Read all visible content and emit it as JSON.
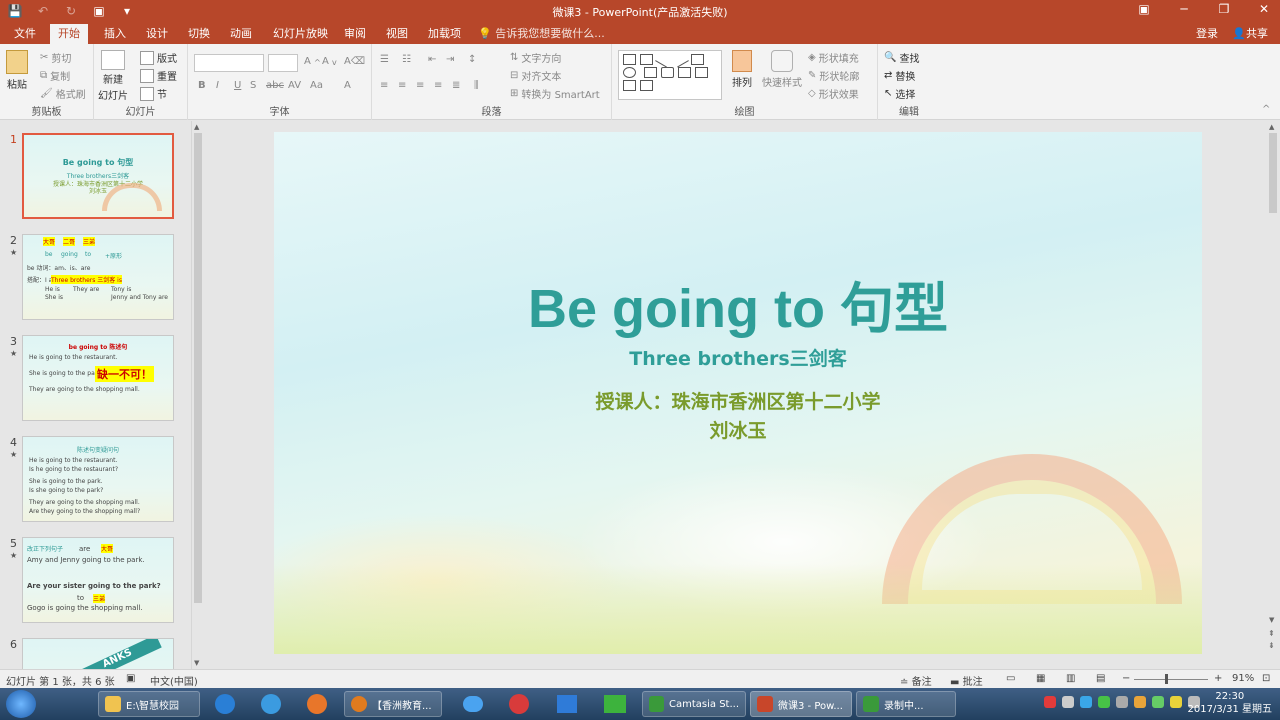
{
  "window": {
    "title": "微课3 - PowerPoint(产品激活失败)"
  },
  "tabs": [
    {
      "label": "文件"
    },
    {
      "label": "开始"
    },
    {
      "label": "插入"
    },
    {
      "label": "设计"
    },
    {
      "label": "切换"
    },
    {
      "label": "动画"
    },
    {
      "label": "幻灯片放映"
    },
    {
      "label": "审阅"
    },
    {
      "label": "视图"
    },
    {
      "label": "加载项"
    }
  ],
  "tellme": "告诉我您想要做什么...",
  "account": {
    "login": "登录",
    "share": "共享"
  },
  "ribbon": {
    "clipboard": {
      "paste": "粘贴",
      "cut": "剪切",
      "copy": "复制",
      "format_painter": "格式刷",
      "label": "剪贴板"
    },
    "slides": {
      "new_slide": "新建",
      "new_slide2": "幻灯片",
      "layout": "版式",
      "reset": "重置",
      "section": "节",
      "label": "幻灯片"
    },
    "font": {
      "label": "字体"
    },
    "paragraph": {
      "text_direction": "文字方向",
      "align_text": "对齐文本",
      "smartart": "转换为 SmartArt",
      "label": "段落"
    },
    "drawing": {
      "arrange": "排列",
      "quick_styles": "快速样式",
      "shape_fill": "形状填充",
      "shape_outline": "形状轮廓",
      "shape_effects": "形状效果",
      "label": "绘图"
    },
    "editing": {
      "find": "查找",
      "replace": "替换",
      "select": "选择",
      "label": "编辑"
    }
  },
  "thumbnails": [
    {
      "num": "1",
      "title": "Be going to 句型",
      "lines": [
        "Three brothers三剑客",
        "授课人：珠海市香洲区第十二小学",
        "刘冰玉"
      ]
    },
    {
      "num": "2",
      "lines": [
        "大哥",
        "二哥",
        "三弟",
        "be",
        "going",
        "to",
        "+原形",
        "be 动词：am、is、are",
        "搭配：I am",
        "Three brothers 三剑客 is",
        "He is",
        "They are",
        "Tony is",
        "She is",
        "Jenny and Tony are"
      ]
    },
    {
      "num": "3",
      "lines": [
        "be going to 陈述句",
        "He is going to the restaurant.",
        "She is going to the park.",
        "缺一不可！",
        "They are going to the shopping mall."
      ]
    },
    {
      "num": "4",
      "lines": [
        "陈述句变疑问句",
        "He is going to the restaurant.",
        "Is he going to the restaurant?",
        "She is going to the park.",
        "Is she going to the park?",
        "They are going to the shopping mall.",
        "Are they going to the shopping mall?"
      ]
    },
    {
      "num": "5",
      "lines": [
        "改正下列句子",
        "are",
        "大哥",
        "Amy and Jenny going to the park.",
        "Are your sister going to the park?",
        "to",
        "三弟",
        "Gogo is going the shopping mall."
      ]
    },
    {
      "num": "6",
      "lines": [
        "ANKS"
      ]
    }
  ],
  "slide": {
    "title": "Be going to 句型",
    "subtitle": "Three brothers三剑客",
    "teacher_line1": "授课人：珠海市香洲区第十二小学",
    "teacher_line2": "刘冰玉"
  },
  "statusbar": {
    "slide_info": "幻灯片 第 1 张，共 6 张",
    "language": "中文(中国)",
    "notes": "备注",
    "comments": "批注",
    "zoom": "91%"
  },
  "taskbar": {
    "apps": [
      {
        "label": "E:\\智慧校园"
      },
      {
        "label": "【香洲教育..."
      },
      {
        "label": "Camtasia St..."
      },
      {
        "label": "微课3 - Pow..."
      },
      {
        "label": "录制中..."
      }
    ],
    "time": "22:30",
    "date": "2017/3/31 星期五"
  },
  "colors": {
    "accent": "#b7472a",
    "slide_title": "#2f9e98",
    "slide_teacher": "#7a9b2c"
  }
}
